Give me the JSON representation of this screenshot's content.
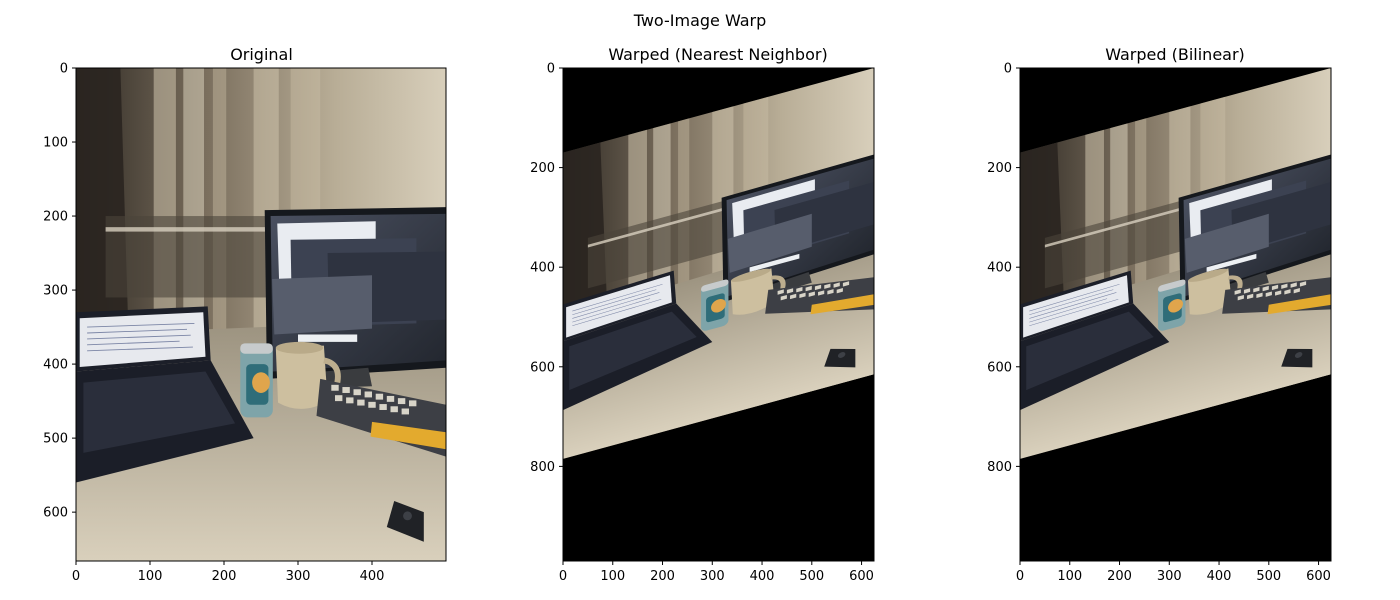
{
  "chart_data": [
    {
      "type": "image",
      "title": "Original",
      "xlim": [
        0,
        500
      ],
      "ylim": [
        666,
        0
      ],
      "xticks": [
        0,
        100,
        200,
        300,
        400
      ],
      "yticks": [
        0,
        100,
        200,
        300,
        400,
        500,
        600
      ],
      "content": "photo of a desk with a laptop, a monitor, a can, a mug and a keyboard",
      "warp": "none"
    },
    {
      "type": "image",
      "title": "Warped (Nearest Neighbor)",
      "xlim": [
        0,
        625
      ],
      "ylim": [
        990,
        0
      ],
      "xticks": [
        0,
        100,
        200,
        300,
        400,
        500,
        600
      ],
      "yticks": [
        0,
        200,
        400,
        600,
        800
      ],
      "content": "same photo after a skew warp, black background outside the warped region",
      "warp": "nearest"
    },
    {
      "type": "image",
      "title": "Warped (Bilinear)",
      "xlim": [
        0,
        625
      ],
      "ylim": [
        990,
        0
      ],
      "xticks": [
        0,
        100,
        200,
        300,
        400,
        500,
        600
      ],
      "yticks": [
        0,
        200,
        400,
        600,
        800
      ],
      "content": "same photo after a skew warp, black background outside the warped region",
      "warp": "bilinear"
    }
  ],
  "figure": {
    "suptitle": "Two-Image Warp"
  },
  "colors": {
    "background": "#ffffff",
    "fill": "#000000",
    "wall": "#c9bfa8",
    "desk": "#cdc3ad",
    "monitor": "#1a1d22",
    "screen": "#3b4150",
    "laptop": "#222633",
    "keyboard_key": "#dcd8cc",
    "keyboard_accent": "#e3aa2e"
  }
}
